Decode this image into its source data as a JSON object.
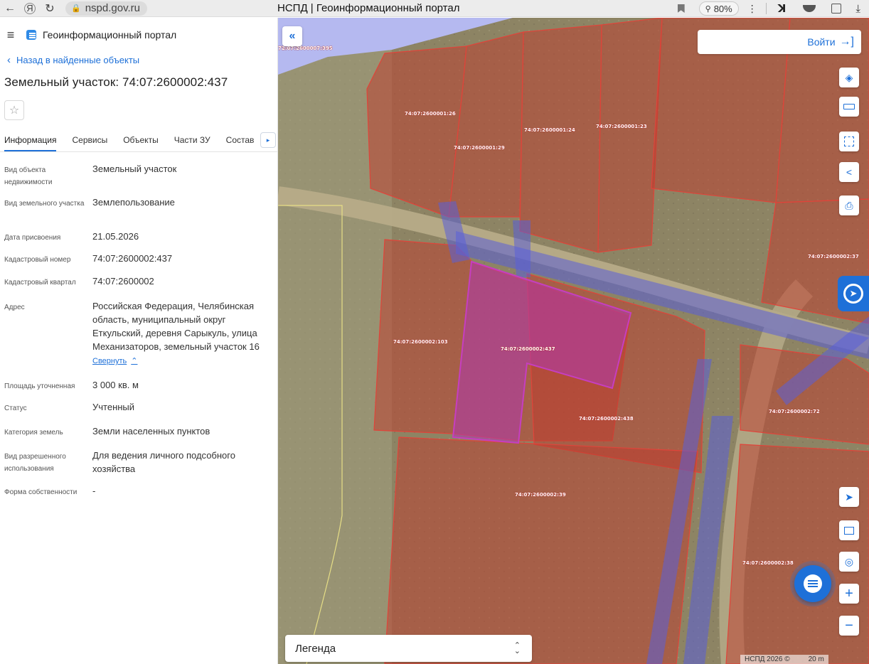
{
  "browser": {
    "back_icon": "←",
    "yandex_icon": "Я",
    "reload_icon": "↻",
    "lock_icon": "🔒",
    "url": "nspd.gov.ru",
    "tab_title": "НСПД | Геоинформационный портал",
    "zoom": "80%",
    "menu_icon": "⋮"
  },
  "panel": {
    "app_title": "Геоинформационный портал",
    "back_label": "Назад в найденные объекты",
    "object_title": "Земельный участок: 74:07:2600002:437",
    "star_icon": "☆",
    "tabs": [
      "Информация",
      "Сервисы",
      "Объекты",
      "Части ЗУ",
      "Состав"
    ],
    "tab_more_icon": "▸",
    "fields": {
      "object_type_label": "Вид объекта недвижимости",
      "object_type": "Земельный участок",
      "land_kind_label": "Вид земельного участка",
      "land_kind": "Землепользование",
      "date_label": "Дата присвоения",
      "date": "21.05.2026",
      "cad_number_label": "Кадастровый номер",
      "cad_number": "74:07:2600002:437",
      "cad_quarter_label": "Кадастровый квартал",
      "cad_quarter": "74:07:2600002",
      "address_label": "Адрес",
      "address": "Российская Федерация, Челябинская область, муниципальный округ Еткульский, деревня Сарыкуль, улица Механизаторов, земельный участок 16",
      "collapse_label": "Свернуть",
      "collapse_icon": "⌃",
      "area_label": "Площадь уточненная",
      "area": "3 000 кв. м",
      "status_label": "Статус",
      "status": "Учтенный",
      "category_label": "Категория земель",
      "category": "Земли населенных пунктов",
      "permitted_use_label": "Вид разрешенного использования",
      "permitted_use": "Для ведения личного подсобного хозяйства",
      "ownership_label": "Форма собственности",
      "ownership": "-"
    }
  },
  "map": {
    "collapse_icon": "«",
    "login_label": "Войти",
    "login_icon": "→]",
    "legend_label": "Легенда",
    "legend_icon": "⌃⌄",
    "copyright": "НСПД 2026 ©",
    "scale": "20 m",
    "parcel_labels": {
      "top_edge": "72:07:2600007:395",
      "p126": "74:07:2600001:26",
      "p124": "74:07:2600001:24",
      "p123": "74:07:2600001:23",
      "p129": "74:07:2600001:29",
      "p_right_top": "74:07:2600002:37",
      "p_left_mid": "74:07:2600002:103",
      "p437": "74:07:2600002:437",
      "p438": "74:07:2600002:438",
      "p172": "74:07:2600002:72",
      "p_mid_low": "74:07:2600002:39",
      "p_right_low": "74:07:2600002:38"
    },
    "tools": {
      "layers_icon": "layers-icon",
      "ruler_icon": "ruler-icon",
      "select_icon": "select-area-icon",
      "share_icon": "share-icon",
      "print_icon": "print-icon",
      "locate_icon": "locate-icon",
      "minimap_icon": "minimap-icon",
      "geo_icon": "geolocation-icon",
      "zoom_in": "+",
      "zoom_out": "−"
    },
    "colors": {
      "accent": "#1e70d8",
      "parcel_fill": "#c0392b",
      "selected_fill": "#b03aa8",
      "zone_fill": "#5a5fd8"
    }
  }
}
